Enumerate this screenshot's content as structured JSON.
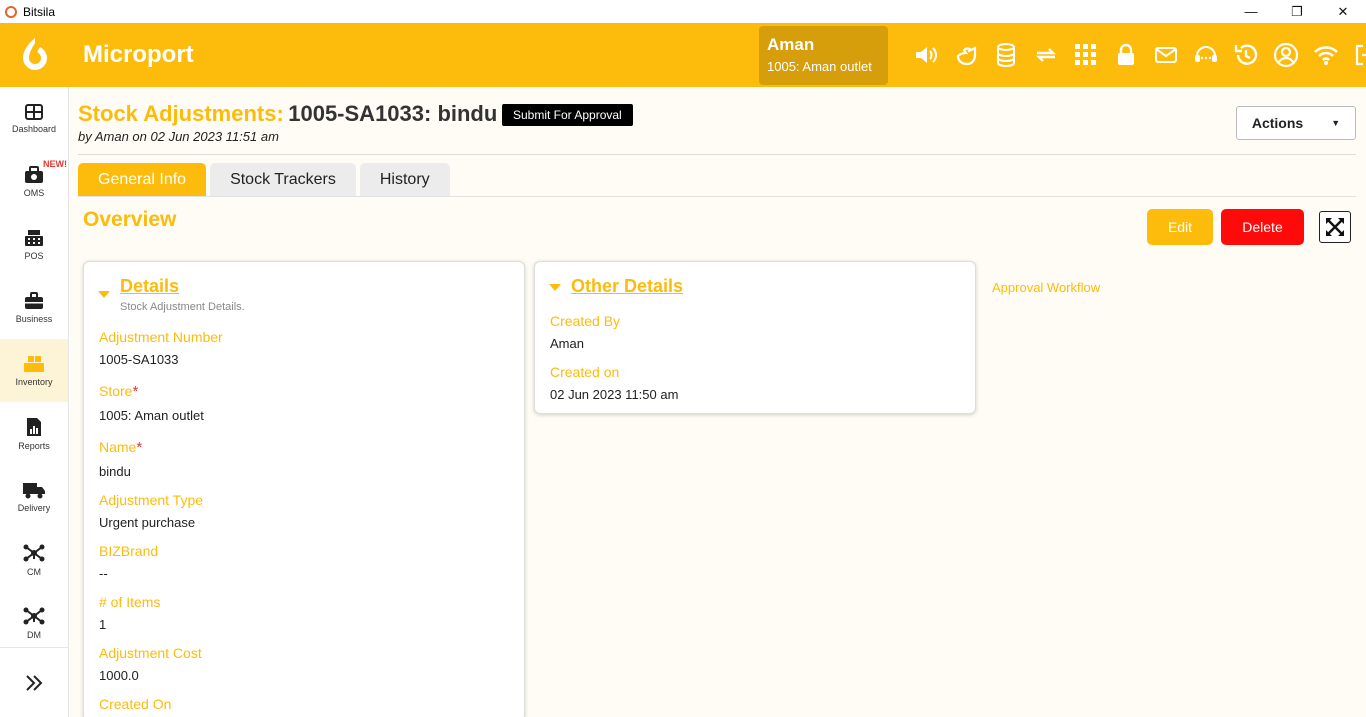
{
  "window": {
    "title": "Bitsila",
    "minimize_glyph": "—",
    "restore_glyph": "❐",
    "close_glyph": "✕"
  },
  "header": {
    "brand": "Microport",
    "user_name": "Aman",
    "user_store": "1005: Aman outlet",
    "icons": [
      "speaker-icon",
      "bird-icon",
      "database-icon",
      "sync-icon",
      "apps-grid-icon",
      "lock-icon",
      "mail-icon",
      "support-icon",
      "history-icon",
      "user-icon",
      "wifi-icon",
      "logout-icon"
    ]
  },
  "sidebar": {
    "items": [
      {
        "label": "Dashboard",
        "icon": "dashboard-icon"
      },
      {
        "label": "OMS",
        "icon": "oms-icon",
        "badge": "NEW!"
      },
      {
        "label": "POS",
        "icon": "pos-icon"
      },
      {
        "label": "Business",
        "icon": "briefcase-icon"
      },
      {
        "label": "Inventory",
        "icon": "inventory-icon"
      },
      {
        "label": "Reports",
        "icon": "reports-icon"
      },
      {
        "label": "Delivery",
        "icon": "truck-icon"
      },
      {
        "label": "CM",
        "icon": "network-icon"
      },
      {
        "label": "DM",
        "icon": "network-icon"
      }
    ],
    "active": "Inventory"
  },
  "page": {
    "title_prefix": "Stock Adjustments:",
    "title_id": "1005-SA1033: bindu",
    "subtitle": "by Aman on 02 Jun 2023 11:51 am",
    "submit_label": "Submit For Approval",
    "actions_label": "Actions",
    "tabs": [
      "General Info",
      "Stock Trackers",
      "History"
    ],
    "active_tab": "General Info",
    "overview_title": "Overview",
    "edit_label": "Edit",
    "delete_label": "Delete"
  },
  "details": {
    "title": "Details",
    "description": "Stock Adjustment Details.",
    "fields": [
      {
        "label": "Adjustment Number",
        "value": "1005-SA1033",
        "required": false
      },
      {
        "label": "Store",
        "value": "1005: Aman outlet",
        "required": true
      },
      {
        "label": "Name",
        "value": "bindu",
        "required": true
      },
      {
        "label": "Adjustment Type",
        "value": "Urgent purchase",
        "required": false
      },
      {
        "label": "BIZBrand",
        "value": "--",
        "required": false
      },
      {
        "label": "# of Items",
        "value": "1",
        "required": false
      },
      {
        "label": "Adjustment Cost",
        "value": "1000.0",
        "required": false
      },
      {
        "label": "Created On",
        "value": "",
        "required": false
      }
    ],
    "required_mark": "*"
  },
  "other_details": {
    "title": "Other Details",
    "fields": [
      {
        "label": "Created By",
        "value": "Aman"
      },
      {
        "label": "Created on",
        "value": "02 Jun 2023 11:50 am"
      }
    ]
  },
  "approval_workflow_label": "Approval Workflow",
  "colors": {
    "accent": "#fdbb0b",
    "danger": "#ff0a0a",
    "user_box": "#d79e0b"
  }
}
